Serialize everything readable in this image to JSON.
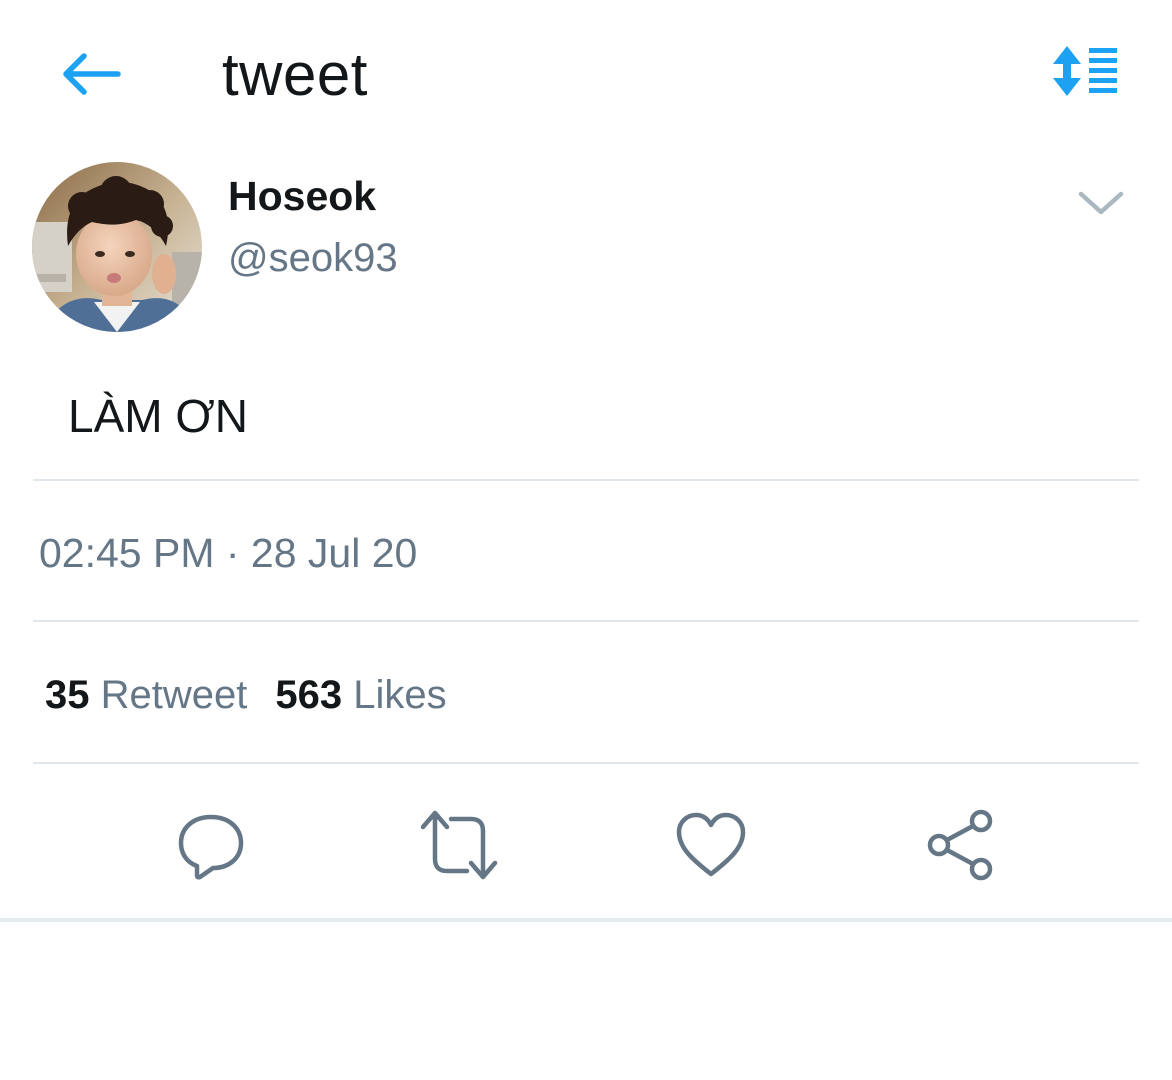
{
  "header": {
    "title": "tweet",
    "back_icon": "arrow-left-icon",
    "sort_icon": "sort-lines-icon",
    "accent_color": "#1da1f2"
  },
  "tweet": {
    "author": {
      "display_name": "Hoseok",
      "handle": "@seok93",
      "avatar_icon": "profile-photo"
    },
    "text": "LÀM ƠN",
    "timestamp": "02:45 PM · 28 Jul 20",
    "stats": {
      "retweets_count": "35",
      "retweets_label": "Retweet",
      "likes_count": "563",
      "likes_label": "Likes"
    },
    "menu_icon": "chevron-down-icon"
  },
  "actions": [
    {
      "icon": "reply-icon"
    },
    {
      "icon": "retweet-icon"
    },
    {
      "icon": "heart-icon"
    },
    {
      "icon": "share-icon"
    }
  ],
  "colors": {
    "text_primary": "#14171a",
    "text_secondary": "#657786",
    "divider": "#e1e8ed"
  }
}
